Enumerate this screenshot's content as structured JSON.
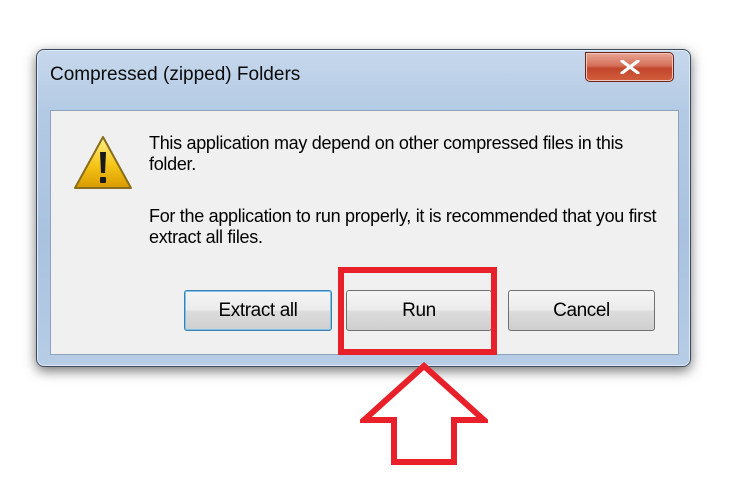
{
  "dialog": {
    "title": "Compressed (zipped) Folders",
    "close_icon": "close-icon",
    "warning_icon": "warning-icon",
    "message_line1": "This application may depend on other compressed files in this folder.",
    "message_line2": "For the application to run properly, it is recommended that you first extract all files.",
    "buttons": {
      "extract_all": "Extract all",
      "run": "Run",
      "cancel": "Cancel"
    }
  },
  "annotation": {
    "highlight_color": "#e8202a",
    "arrow_icon": "up-arrow-icon"
  },
  "colors": {
    "title_bar": "#b3cae4",
    "close_button": "#c1452b",
    "content_bg": "#f0f0f0",
    "default_button_border": "#3c7fb1"
  }
}
